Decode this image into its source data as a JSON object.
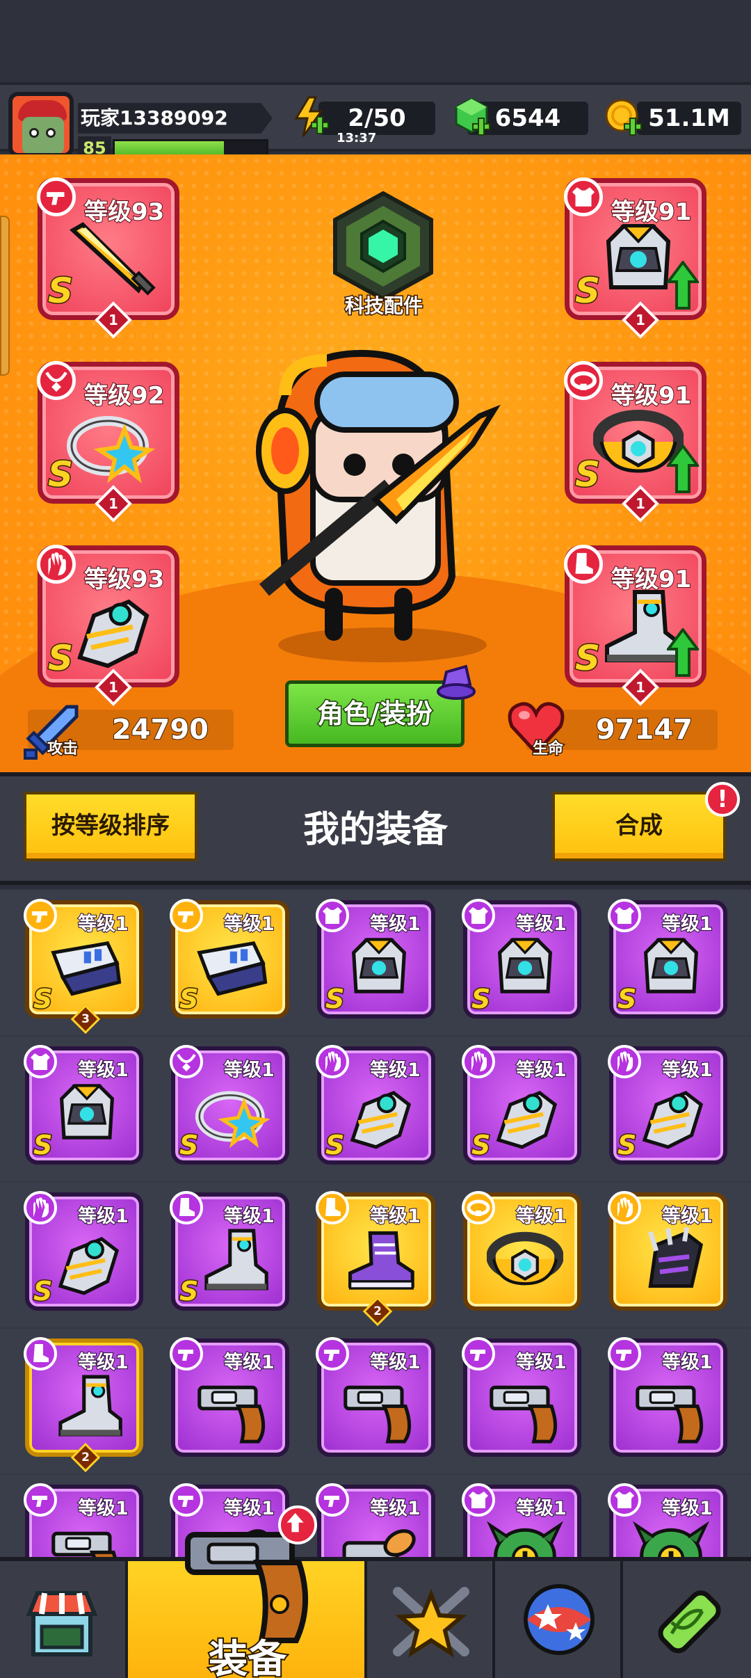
{
  "player": {
    "name": "玩家13389092",
    "level": "85",
    "xp_fraction": 0.72
  },
  "resources": {
    "energy": {
      "value": "2/50",
      "timer": "13:37",
      "icon": "energy-bolt-icon"
    },
    "gems": {
      "value": "6544",
      "icon": "green-gem-icon"
    },
    "coins": {
      "value": "51.1M",
      "icon": "gold-coin-icon"
    }
  },
  "tech_parts": {
    "label": "科技配件"
  },
  "equipped": [
    {
      "slot": "weapon",
      "level": "等级93",
      "rank": "S",
      "stars": "1",
      "upgradable": false,
      "icon": "sword"
    },
    {
      "slot": "necklace",
      "level": "等级92",
      "rank": "S",
      "stars": "1",
      "upgradable": false,
      "icon": "star-ring"
    },
    {
      "slot": "gloves",
      "level": "等级93",
      "rank": "S",
      "stars": "1",
      "upgradable": false,
      "icon": "gauntlet"
    },
    {
      "slot": "armor",
      "level": "等级91",
      "rank": "S",
      "stars": "1",
      "upgradable": true,
      "icon": "armor"
    },
    {
      "slot": "belt",
      "level": "等级91",
      "rank": "S",
      "stars": "1",
      "upgradable": true,
      "icon": "belt"
    },
    {
      "slot": "boots",
      "level": "等级91",
      "rank": "S",
      "stars": "1",
      "upgradable": true,
      "icon": "boot"
    }
  ],
  "stats": {
    "attack": {
      "label": "攻击",
      "value": "24790"
    },
    "health": {
      "label": "生命",
      "value": "97147"
    }
  },
  "role_button": "角色/装扮",
  "toolbar": {
    "sort_label": "按等级排序",
    "title": "我的装备",
    "merge_label": "合成",
    "merge_alert": "!"
  },
  "inventory": [
    {
      "level": "等级1",
      "rank": "S",
      "frame": "gold",
      "slot": "weapon",
      "art": "blaster",
      "count": "3"
    },
    {
      "level": "等级1",
      "rank": "S",
      "frame": "gold",
      "slot": "weapon",
      "art": "blaster",
      "count": ""
    },
    {
      "level": "等级1",
      "rank": "S",
      "frame": "purple",
      "slot": "armor",
      "art": "armor",
      "count": ""
    },
    {
      "level": "等级1",
      "rank": "S",
      "frame": "purple",
      "slot": "armor",
      "art": "armor",
      "count": ""
    },
    {
      "level": "等级1",
      "rank": "S",
      "frame": "purple",
      "slot": "armor",
      "art": "armor",
      "count": ""
    },
    {
      "level": "等级1",
      "rank": "S",
      "frame": "purple",
      "slot": "armor",
      "art": "armor",
      "count": ""
    },
    {
      "level": "等级1",
      "rank": "S",
      "frame": "purple",
      "slot": "necklace",
      "art": "star-ring",
      "count": ""
    },
    {
      "level": "等级1",
      "rank": "S",
      "frame": "purple",
      "slot": "gloves",
      "art": "gauntlet",
      "count": ""
    },
    {
      "level": "等级1",
      "rank": "S",
      "frame": "purple",
      "slot": "gloves",
      "art": "gauntlet",
      "count": ""
    },
    {
      "level": "等级1",
      "rank": "S",
      "frame": "purple",
      "slot": "gloves",
      "art": "gauntlet",
      "count": ""
    },
    {
      "level": "等级1",
      "rank": "S",
      "frame": "purple",
      "slot": "gloves",
      "art": "gauntlet",
      "count": ""
    },
    {
      "level": "等级1",
      "rank": "S",
      "frame": "purple",
      "slot": "boots",
      "art": "boot",
      "count": ""
    },
    {
      "level": "等级1",
      "rank": "",
      "frame": "gold",
      "slot": "boots",
      "art": "sneaker",
      "count": "2"
    },
    {
      "level": "等级1",
      "rank": "",
      "frame": "gold",
      "slot": "belt",
      "art": "belt",
      "count": ""
    },
    {
      "level": "等级1",
      "rank": "",
      "frame": "gold",
      "slot": "gloves",
      "art": "claw",
      "count": ""
    },
    {
      "level": "等级1",
      "rank": "",
      "frame": "gold-frame",
      "slot": "boots",
      "art": "boot",
      "count": "2"
    },
    {
      "level": "等级1",
      "rank": "",
      "frame": "purple",
      "slot": "weapon",
      "art": "revolver",
      "count": ""
    },
    {
      "level": "等级1",
      "rank": "",
      "frame": "purple",
      "slot": "weapon",
      "art": "revolver",
      "count": ""
    },
    {
      "level": "等级1",
      "rank": "",
      "frame": "purple",
      "slot": "weapon",
      "art": "revolver",
      "count": ""
    },
    {
      "level": "等级1",
      "rank": "",
      "frame": "purple",
      "slot": "weapon",
      "art": "revolver",
      "count": ""
    },
    {
      "level": "等级1",
      "rank": "",
      "frame": "purple",
      "slot": "weapon",
      "art": "revolver",
      "count": ""
    },
    {
      "level": "等级1",
      "rank": "",
      "frame": "purple",
      "slot": "weapon",
      "art": "rocket",
      "count": ""
    },
    {
      "level": "等级1",
      "rank": "",
      "frame": "purple",
      "slot": "weapon",
      "art": "rocket",
      "count": ""
    },
    {
      "level": "等级1",
      "rank": "",
      "frame": "purple",
      "slot": "armor",
      "art": "dragon",
      "count": ""
    },
    {
      "level": "等级1",
      "rank": "",
      "frame": "purple",
      "slot": "armor",
      "art": "dragon",
      "count": ""
    }
  ],
  "nav": [
    {
      "id": "shop",
      "label": "",
      "icon": "shop-icon"
    },
    {
      "id": "equipment",
      "label": "装备",
      "icon": "revolver-icon",
      "active": true
    },
    {
      "id": "talent",
      "label": "",
      "icon": "star-swords-icon"
    },
    {
      "id": "pets",
      "label": "",
      "icon": "orb-icon"
    },
    {
      "id": "evolution",
      "label": "",
      "icon": "dna-capsule-icon"
    }
  ],
  "colors": {
    "hero_bg": "#ff9a12",
    "slot_red": "#f0415a",
    "rare_purple": "#b633e0",
    "legend_gold": "#ffc10e",
    "button_green": "#46b822"
  }
}
